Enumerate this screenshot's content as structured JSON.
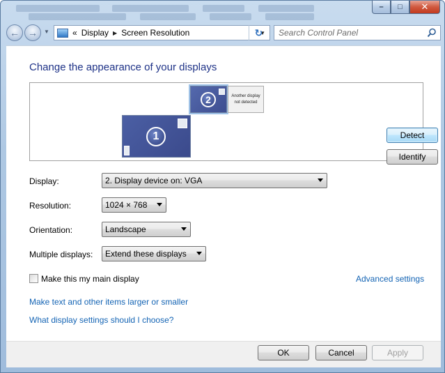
{
  "window": {
    "minimize_glyph": "–",
    "maximize_glyph": "□",
    "close_glyph": "✕"
  },
  "navbar": {
    "back_glyph": "←",
    "forward_glyph": "→",
    "breadcrumb_overflow": "«",
    "breadcrumb": [
      "Display",
      "Screen Resolution"
    ],
    "separator_glyph": "▶",
    "refresh_glyph": "↻",
    "search_placeholder": "Search Control Panel"
  },
  "main": {
    "heading": "Change the appearance of your displays",
    "preview": {
      "monitor1_number": "1",
      "monitor2_number": "2",
      "ghost_line1": "Another display",
      "ghost_line2": "not detected"
    },
    "detect_label": "Detect",
    "identify_label": "Identify",
    "fields": {
      "display_label": "Display:",
      "display_value": "2. Display device on: VGA",
      "resolution_label": "Resolution:",
      "resolution_value": "1024 × 768",
      "orientation_label": "Orientation:",
      "orientation_value": "Landscape",
      "multiple_label": "Multiple displays:",
      "multiple_value": "Extend these displays"
    },
    "main_display_checkbox_label": "Make this my main display",
    "main_display_checked": false,
    "advanced_link": "Advanced settings",
    "text_size_link": "Make text and other items larger or smaller",
    "help_link": "What display settings should I choose?"
  },
  "footer": {
    "ok_label": "OK",
    "cancel_label": "Cancel",
    "apply_label": "Apply"
  },
  "colors": {
    "heading": "#1e3287",
    "link": "#1464b4",
    "monitor_fill": "#4b5fa4"
  }
}
